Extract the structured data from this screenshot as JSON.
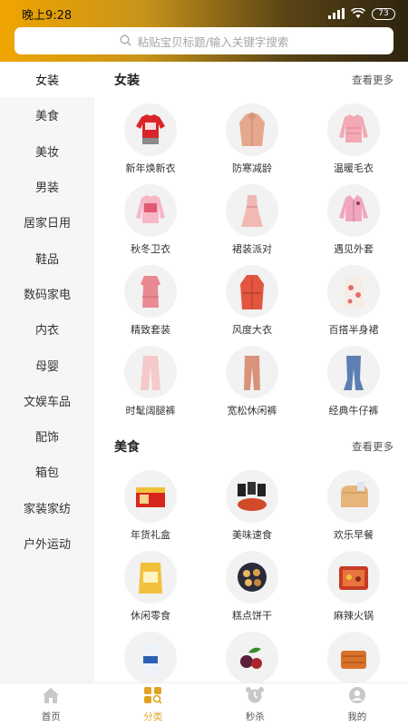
{
  "status": {
    "time": "晚上9:28",
    "battery": "73"
  },
  "search": {
    "placeholder": "粘贴宝贝标题/输入关键字搜索"
  },
  "sidebar": {
    "items": [
      {
        "label": "女装",
        "active": true
      },
      {
        "label": "美食"
      },
      {
        "label": "美妆"
      },
      {
        "label": "男装"
      },
      {
        "label": "居家日用"
      },
      {
        "label": "鞋品"
      },
      {
        "label": "数码家电"
      },
      {
        "label": "内衣"
      },
      {
        "label": "母婴"
      },
      {
        "label": "文娱车品"
      },
      {
        "label": "配饰"
      },
      {
        "label": "箱包"
      },
      {
        "label": "家装家纺"
      },
      {
        "label": "户外运动"
      }
    ]
  },
  "sections": [
    {
      "title": "女装",
      "more": "查看更多",
      "items": [
        {
          "label": "新年焕新衣",
          "icon": "red-sweater-icon"
        },
        {
          "label": "防寒减龄",
          "icon": "coat-icon"
        },
        {
          "label": "温暖毛衣",
          "icon": "pink-sweater-icon"
        },
        {
          "label": "秋冬卫衣",
          "icon": "sweatshirt-icon"
        },
        {
          "label": "裙装派对",
          "icon": "dress-icon"
        },
        {
          "label": "遇见外套",
          "icon": "jacket-icon"
        },
        {
          "label": "精致套装",
          "icon": "suit-dress-icon"
        },
        {
          "label": "风度大衣",
          "icon": "red-coat-icon"
        },
        {
          "label": "百搭半身裙",
          "icon": "skirt-icon"
        },
        {
          "label": "时髦阔腿裤",
          "icon": "wide-pants-icon"
        },
        {
          "label": "宽松休闲裤",
          "icon": "casual-pants-icon"
        },
        {
          "label": "经典牛仔裤",
          "icon": "jeans-icon"
        }
      ]
    },
    {
      "title": "美食",
      "more": "查看更多",
      "items": [
        {
          "label": "年货礼盒",
          "icon": "gift-box-icon"
        },
        {
          "label": "美味速食",
          "icon": "instant-food-icon"
        },
        {
          "label": "欢乐早餐",
          "icon": "bread-icon"
        },
        {
          "label": "休闲零食",
          "icon": "snack-bag-icon"
        },
        {
          "label": "糕点饼干",
          "icon": "biscuit-icon"
        },
        {
          "label": "麻辣火锅",
          "icon": "hotpot-icon"
        },
        {
          "label": "",
          "icon": "milk-icon"
        },
        {
          "label": "",
          "icon": "fruit-icon"
        },
        {
          "label": "",
          "icon": "jerky-icon"
        }
      ]
    }
  ],
  "tabs": [
    {
      "label": "首页",
      "icon": "home-icon"
    },
    {
      "label": "分类",
      "icon": "category-icon",
      "active": true
    },
    {
      "label": "秒杀",
      "icon": "alarm-clock-icon"
    },
    {
      "label": "我的",
      "icon": "profile-icon"
    }
  ],
  "colors": {
    "accent": "#e0a321",
    "header_start": "#f0a500",
    "header_end": "#2e2410",
    "sidebar_bg": "#f6f6f6"
  }
}
